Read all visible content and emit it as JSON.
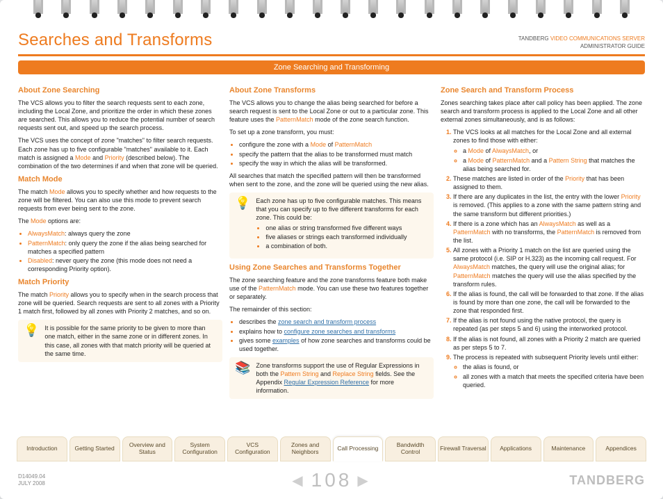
{
  "header": {
    "title": "Searches and Transforms",
    "product_line1_a": "TANDBERG ",
    "product_line1_b": "VIDEO COMMUNICATIONS SERVER",
    "product_line2": "ADMINISTRATOR GUIDE",
    "sub_title": "Zone Searching and Transforming"
  },
  "col1": {
    "h1": "About Zone Searching",
    "p1": "The VCS allows you to filter the search requests sent to each zone, including the Local Zone, and prioritize the order in which these zones are searched.  This allows you to reduce the potential number of search requests sent out, and speed up the search process.",
    "p2a": "The VCS uses the concept of zone \"matches\" to filter search requests.  Each zone has up to five configurable \"matches\" available to it.  Each match is assigned a ",
    "p2_mode": "Mode",
    "p2_and": " and ",
    "p2_priority": "Priority",
    "p2b": " (described below).  The combination of the two determines if and when that zone will be queried.",
    "h2": "Match Mode",
    "p3a": "The match ",
    "p3_mode": "Mode",
    "p3b": " allows you to specify whether and how requests to the zone will be filtered.  You can also use this mode to prevent search requests from ever being sent to the zone.",
    "p4a": "The ",
    "p4_mode": "Mode",
    "p4b": " options are:",
    "li1_k": "AlwaysMatch",
    "li1_t": ": always query the zone",
    "li2_k": "PatternMatch",
    "li2_t": ": only query the zone if the alias being searched for matches a specified pattern",
    "li3_k": "Disabled",
    "li3_t": ": never query the zone (this mode does not need a corresponding Priority option).",
    "h3": "Match Priority",
    "p5a": "The match ",
    "p5_priority": "Priority",
    "p5b": " allows you to specify when in the search process that zone will be queried.  Search requests are sent to all zones with a Priority 1 match first, followed by all zones with Priority 2 matches, and so on.",
    "note": "It is possible for the same priority to be given to more than one match, either in the same zone or in different zones.  In this case, all zones with that match priority will be queried at the same time."
  },
  "col2": {
    "h1": "About Zone Transforms",
    "p1a": "The VCS allows you to change the alias being searched for before a search request is sent to the Local Zone or out to a particular zone.  This feature uses the ",
    "p1_pm": "PatternMatch",
    "p1b": " mode of the zone search function.",
    "p2": "To set up a zone transform, you must:",
    "li1a": "configure the zone with a ",
    "li1_mode": "Mode",
    "li1b": " of ",
    "li1_pm": "PatternMatch",
    "li2": "specify the pattern that the alias to be transformed must match",
    "li3": "specify the way in which the alias will be transformed.",
    "p3": "All searches that match the specified pattern will then be transformed when sent to the zone, and the zone will be queried using the new alias.",
    "note1": "Each zone has up to five configurable matches.  This means that you can specify up to five different transforms for each zone.  This could be:",
    "n1_li1": "one alias or string transformed five different ways",
    "n1_li2": "five aliases or strings each transformed individually",
    "n1_li3": "a combination of both.",
    "h2": "Using Zone Searches and Transforms Together",
    "p4a": "The zone searching feature and the zone transforms feature both make use of the ",
    "p4_pm": "PatternMatch",
    "p4b": " mode.  You can use these two features together or separately.",
    "p5": "The remainder of this section:",
    "li4a": "describes the ",
    "li4_lk": "zone search and transform process",
    "li5a": "explains how to ",
    "li5_lk": "configure zone searches and transforms",
    "li6a": "gives some ",
    "li6_lk": "examples",
    "li6b": " of how zone searches and transforms could be used together.",
    "note2a": "Zone transforms support the use of Regular Expressions in both the ",
    "note2_ps": "Pattern String",
    "note2_and": " and ",
    "note2_rs": "Replace String",
    "note2b": " fields.  See the Appendix ",
    "note2_lk": "Regular Expression Reference",
    "note2c": " for more information."
  },
  "col3": {
    "h1": "Zone Search and Transform Process",
    "p1": "Zones searching takes place after call policy has been applied. The zone search and transform process is applied to the Local Zone and all other external zones simultaneously, and is as follows:",
    "li1": "The VCS looks at all matches for the Local Zone and all external zones to find those with either:",
    "li1_s1a": "a ",
    "li1_s1_mode": "Mode",
    "li1_s1b": " of ",
    "li1_s1_am": "AlwaysMatch",
    "li1_s1c": ", or",
    "li1_s2a": "a ",
    "li1_s2_mode": "Mode",
    "li1_s2b": " of ",
    "li1_s2_pm": "PatternMatch",
    "li1_s2c": " and a ",
    "li1_s2_ps": "Pattern String",
    "li1_s2d": " that matches the alias being searched for.",
    "li2a": "These matches are listed in order of the ",
    "li2_pri": "Priority",
    "li2b": " that has been assigned to them.",
    "li3a": "If there are any duplicates in the list, the entry with the lower ",
    "li3_pri": "Priority",
    "li3b": " is removed.  (This applies to a zone with the same pattern string and the same transform but different priorities.)",
    "li4a": "If there is a zone which has an ",
    "li4_am": "AlwaysMatch",
    "li4b": " as well as a ",
    "li4_pm": "PatternMatch",
    "li4c": " with no transforms, the ",
    "li4_pm2": "PatternMatch",
    "li4d": " is removed from the list.",
    "li5a": "All zones with a Priority 1 match on the list are queried using the same protocol (i.e. SIP or H.323) as the incoming call request.  For ",
    "li5_am": "AlwaysMatch",
    "li5b": " matches, the query will use the original alias; for ",
    "li5_pm": "PatternMatch",
    "li5c": " matches the query will use the alias specified by the transform rules.",
    "li6": "If the alias is found, the call will be forwarded to that zone.  If the alias is found by more than one zone, the call will be forwarded to the zone that responded first.",
    "li7": "If the alias is not found using the native protocol, the query is repeated (as per steps 5 and 6) using the interworked protocol.",
    "li8": "If the alias is not found, all zones with a Priority 2 match are queried as per steps 5 to 7.",
    "li9": "The process is repeated with subsequent Priority levels until either:",
    "li9_s1": "the alias is found, or",
    "li9_s2": "all zones with a match that meets the specified criteria have been queried."
  },
  "tabs": [
    "Introduction",
    "Getting Started",
    "Overview and Status",
    "System Configuration",
    "VCS Configuration",
    "Zones and Neighbors",
    "Call Processing",
    "Bandwidth Control",
    "Firewall Traversal",
    "Applications",
    "Maintenance",
    "Appendices"
  ],
  "active_tab_index": 6,
  "footer": {
    "doc_id": "D14049.04",
    "date": "JULY 2008",
    "page": "108",
    "brand": "TANDBERG"
  }
}
